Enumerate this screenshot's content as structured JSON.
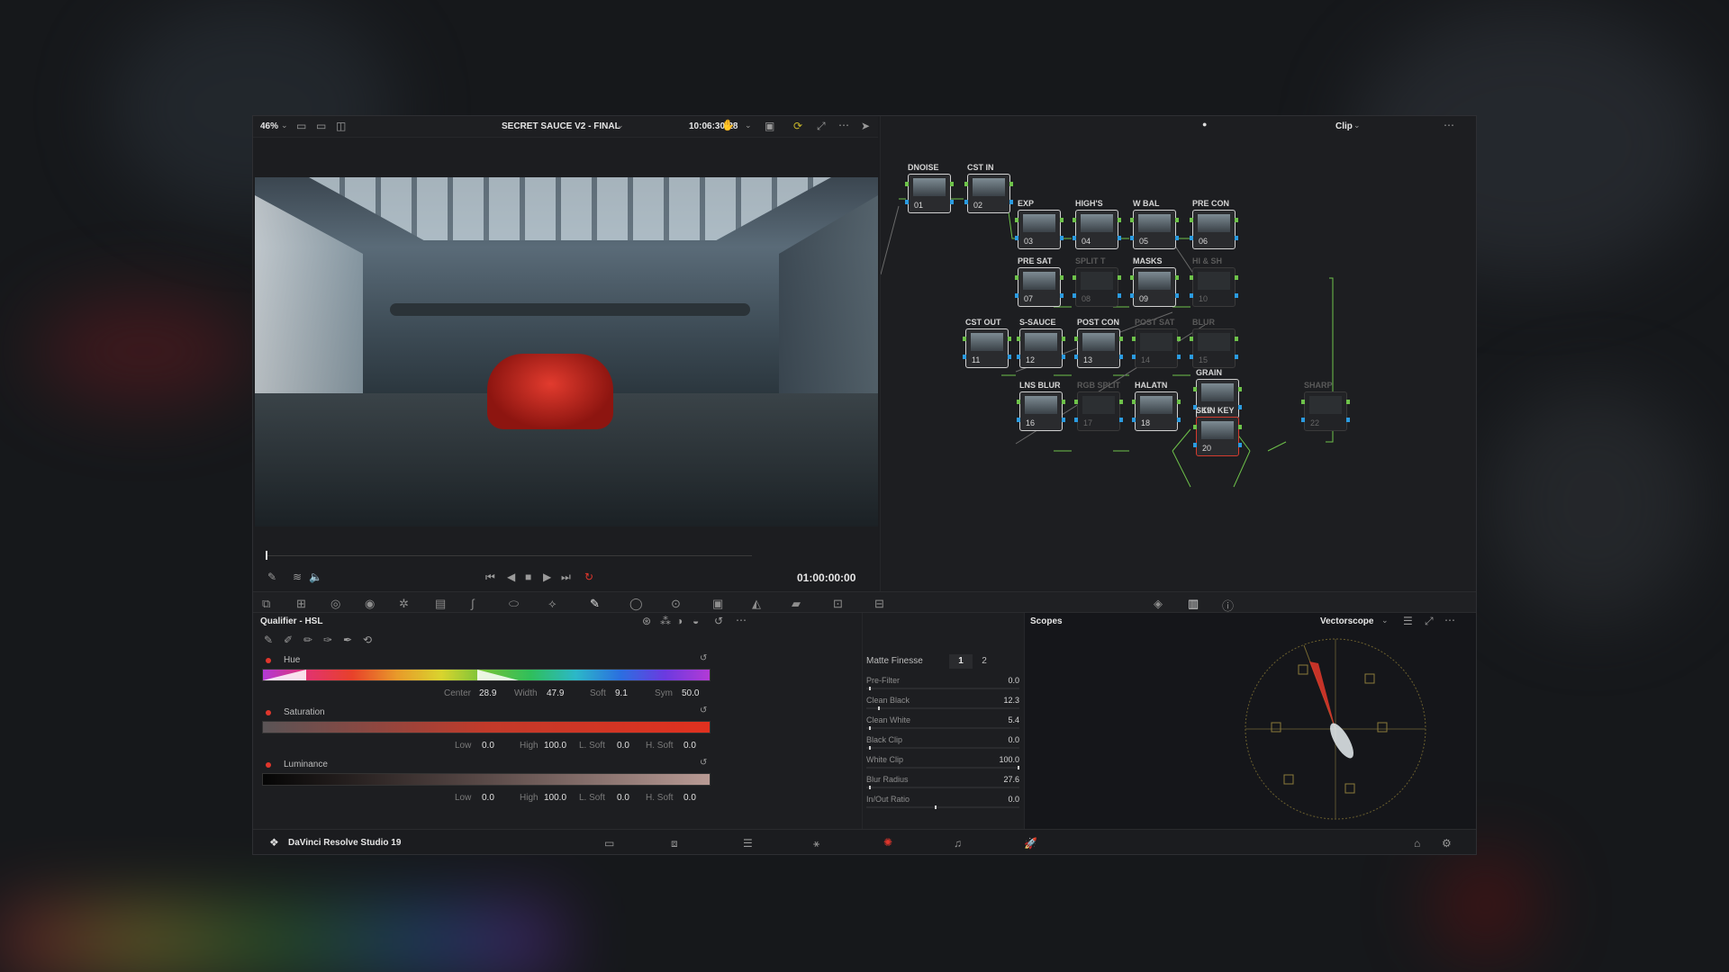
{
  "viewer": {
    "zoom": "46%",
    "project_title": "SECRET SAUCE V2 - FINAL",
    "timecode_top": "10:06:30:28",
    "timecode": "01:00:00:00"
  },
  "node_editor": {
    "mode": "Clip",
    "nodes": [
      {
        "label": "DNOISE",
        "num": "01",
        "active": true
      },
      {
        "label": "CST IN",
        "num": "02",
        "active": true
      },
      {
        "label": "EXP",
        "num": "03",
        "active": true
      },
      {
        "label": "HIGH'S",
        "num": "04",
        "active": true
      },
      {
        "label": "W BAL",
        "num": "05",
        "active": true
      },
      {
        "label": "PRE CON",
        "num": "06",
        "active": true
      },
      {
        "label": "PRE SAT",
        "num": "07",
        "active": true
      },
      {
        "label": "SPLIT T",
        "num": "08",
        "active": false
      },
      {
        "label": "MASKS",
        "num": "09",
        "active": true
      },
      {
        "label": "HI & SH",
        "num": "10",
        "active": false
      },
      {
        "label": "CST OUT",
        "num": "11",
        "active": true
      },
      {
        "label": "S-SAUCE",
        "num": "12",
        "active": true
      },
      {
        "label": "POST CON",
        "num": "13",
        "active": true
      },
      {
        "label": "POST SAT",
        "num": "14",
        "active": false
      },
      {
        "label": "BLUR",
        "num": "15",
        "active": false
      },
      {
        "label": "LNS BLUR",
        "num": "16",
        "active": true
      },
      {
        "label": "RGB SPLIT",
        "num": "17",
        "active": false
      },
      {
        "label": "HALATN",
        "num": "18",
        "active": true
      },
      {
        "label": "GRAIN",
        "num": "19",
        "active": true
      },
      {
        "label": "SKIN KEY",
        "num": "20",
        "active": true
      },
      {
        "label": "SHARP",
        "num": "22",
        "active": false
      }
    ]
  },
  "qualifier": {
    "title": "Qualifier - HSL",
    "hue": {
      "label": "Hue",
      "center_label": "Center",
      "center": "28.9",
      "width_label": "Width",
      "width": "47.9",
      "soft_label": "Soft",
      "soft": "9.1",
      "sym_label": "Sym",
      "sym": "50.0"
    },
    "saturation": {
      "label": "Saturation",
      "low_label": "Low",
      "low": "0.0",
      "high_label": "High",
      "high": "100.0",
      "lsoft_label": "L. Soft",
      "lsoft": "0.0",
      "hsoft_label": "H. Soft",
      "hsoft": "0.0"
    },
    "luminance": {
      "label": "Luminance",
      "low_label": "Low",
      "low": "0.0",
      "high_label": "High",
      "high": "100.0",
      "lsoft_label": "L. Soft",
      "lsoft": "0.0",
      "hsoft_label": "H. Soft",
      "hsoft": "0.0"
    }
  },
  "matte_finesse": {
    "title": "Matte Finesse",
    "tab1": "1",
    "tab2": "2",
    "rows": [
      {
        "name": "Pre-Filter",
        "value": "0.0"
      },
      {
        "name": "Clean Black",
        "value": "12.3"
      },
      {
        "name": "Clean White",
        "value": "5.4"
      },
      {
        "name": "Black Clip",
        "value": "0.0"
      },
      {
        "name": "White Clip",
        "value": "100.0"
      },
      {
        "name": "Blur Radius",
        "value": "27.6"
      },
      {
        "name": "In/Out Ratio",
        "value": "0.0"
      }
    ]
  },
  "scopes": {
    "title": "Scopes",
    "type": "Vectorscope"
  },
  "footer": {
    "app_name": "DaVinci Resolve Studio 19"
  },
  "colors": {
    "accent_red": "#e0362c",
    "node_green": "#6ec24a",
    "node_blue": "#2b9be0"
  }
}
